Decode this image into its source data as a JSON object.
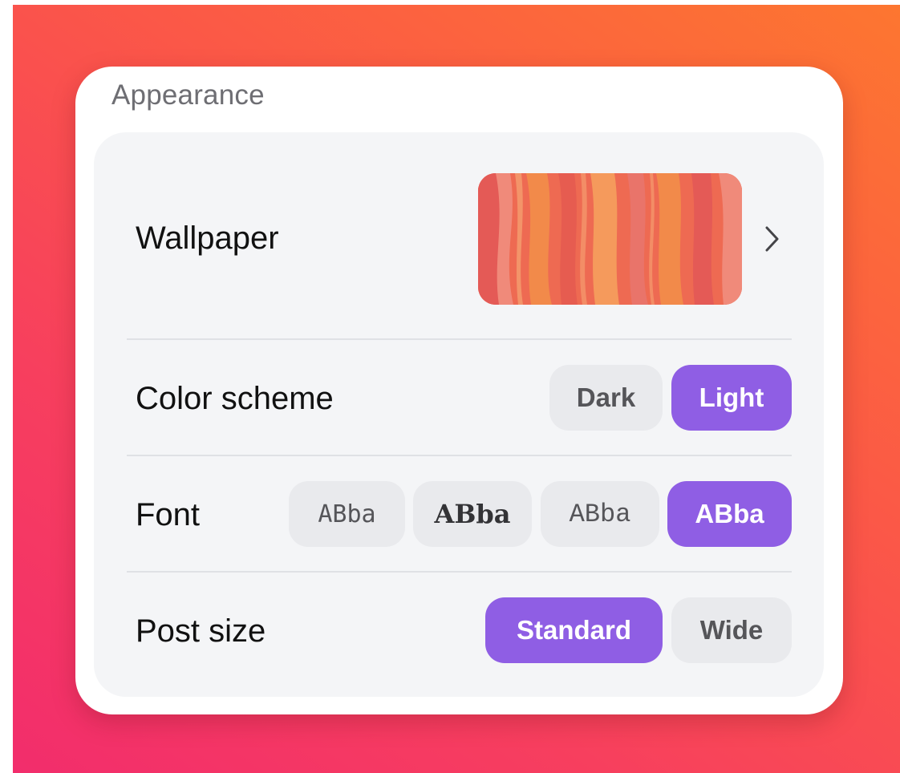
{
  "card": {
    "title": "Appearance"
  },
  "wallpaper": {
    "label": "Wallpaper",
    "thumbnail_colors": [
      "#ee6a52",
      "#f28a4a",
      "#e45a56",
      "#f59a5c",
      "#e9746a"
    ]
  },
  "color_scheme": {
    "label": "Color scheme",
    "options": [
      {
        "label": "Dark",
        "selected": false
      },
      {
        "label": "Light",
        "selected": true
      }
    ]
  },
  "font": {
    "label": "Font",
    "options": [
      {
        "label": "ABba",
        "selected": false
      },
      {
        "label": "ABba",
        "selected": false
      },
      {
        "label": "ABba",
        "selected": false
      },
      {
        "label": "ABba",
        "selected": true
      }
    ]
  },
  "post_size": {
    "label": "Post size",
    "options": [
      {
        "label": "Standard",
        "selected": true
      },
      {
        "label": "Wide",
        "selected": false
      }
    ]
  },
  "colors": {
    "accent": "#8f5ee4",
    "background_gradient": [
      "#fd7630",
      "#f22d6c"
    ],
    "panel": "#f4f5f7",
    "pill_inactive": "#e9eaed"
  }
}
